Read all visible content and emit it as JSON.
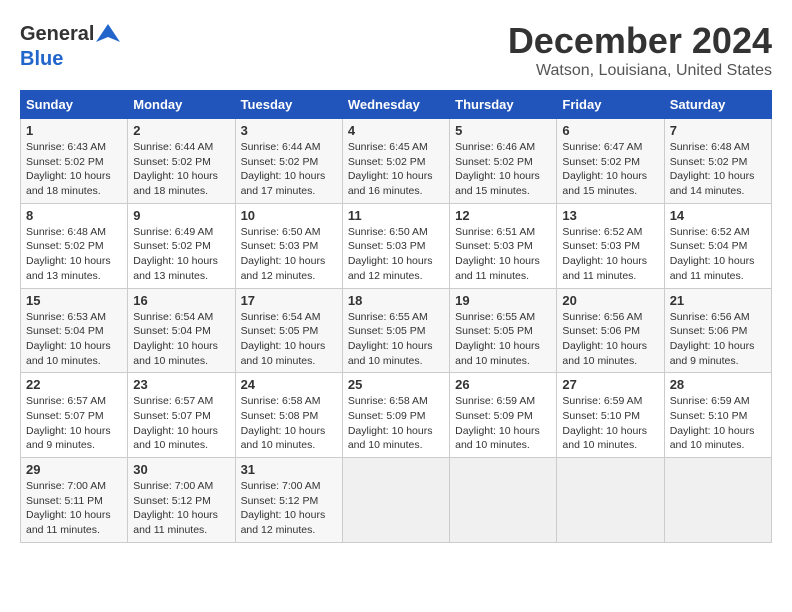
{
  "logo": {
    "general": "General",
    "blue": "Blue"
  },
  "title": "December 2024",
  "location": "Watson, Louisiana, United States",
  "days_header": [
    "Sunday",
    "Monday",
    "Tuesday",
    "Wednesday",
    "Thursday",
    "Friday",
    "Saturday"
  ],
  "weeks": [
    [
      {
        "day": "1",
        "info": "Sunrise: 6:43 AM\nSunset: 5:02 PM\nDaylight: 10 hours\nand 18 minutes."
      },
      {
        "day": "2",
        "info": "Sunrise: 6:44 AM\nSunset: 5:02 PM\nDaylight: 10 hours\nand 18 minutes."
      },
      {
        "day": "3",
        "info": "Sunrise: 6:44 AM\nSunset: 5:02 PM\nDaylight: 10 hours\nand 17 minutes."
      },
      {
        "day": "4",
        "info": "Sunrise: 6:45 AM\nSunset: 5:02 PM\nDaylight: 10 hours\nand 16 minutes."
      },
      {
        "day": "5",
        "info": "Sunrise: 6:46 AM\nSunset: 5:02 PM\nDaylight: 10 hours\nand 15 minutes."
      },
      {
        "day": "6",
        "info": "Sunrise: 6:47 AM\nSunset: 5:02 PM\nDaylight: 10 hours\nand 15 minutes."
      },
      {
        "day": "7",
        "info": "Sunrise: 6:48 AM\nSunset: 5:02 PM\nDaylight: 10 hours\nand 14 minutes."
      }
    ],
    [
      {
        "day": "8",
        "info": "Sunrise: 6:48 AM\nSunset: 5:02 PM\nDaylight: 10 hours\nand 13 minutes."
      },
      {
        "day": "9",
        "info": "Sunrise: 6:49 AM\nSunset: 5:02 PM\nDaylight: 10 hours\nand 13 minutes."
      },
      {
        "day": "10",
        "info": "Sunrise: 6:50 AM\nSunset: 5:03 PM\nDaylight: 10 hours\nand 12 minutes."
      },
      {
        "day": "11",
        "info": "Sunrise: 6:50 AM\nSunset: 5:03 PM\nDaylight: 10 hours\nand 12 minutes."
      },
      {
        "day": "12",
        "info": "Sunrise: 6:51 AM\nSunset: 5:03 PM\nDaylight: 10 hours\nand 11 minutes."
      },
      {
        "day": "13",
        "info": "Sunrise: 6:52 AM\nSunset: 5:03 PM\nDaylight: 10 hours\nand 11 minutes."
      },
      {
        "day": "14",
        "info": "Sunrise: 6:52 AM\nSunset: 5:04 PM\nDaylight: 10 hours\nand 11 minutes."
      }
    ],
    [
      {
        "day": "15",
        "info": "Sunrise: 6:53 AM\nSunset: 5:04 PM\nDaylight: 10 hours\nand 10 minutes."
      },
      {
        "day": "16",
        "info": "Sunrise: 6:54 AM\nSunset: 5:04 PM\nDaylight: 10 hours\nand 10 minutes."
      },
      {
        "day": "17",
        "info": "Sunrise: 6:54 AM\nSunset: 5:05 PM\nDaylight: 10 hours\nand 10 minutes."
      },
      {
        "day": "18",
        "info": "Sunrise: 6:55 AM\nSunset: 5:05 PM\nDaylight: 10 hours\nand 10 minutes."
      },
      {
        "day": "19",
        "info": "Sunrise: 6:55 AM\nSunset: 5:05 PM\nDaylight: 10 hours\nand 10 minutes."
      },
      {
        "day": "20",
        "info": "Sunrise: 6:56 AM\nSunset: 5:06 PM\nDaylight: 10 hours\nand 10 minutes."
      },
      {
        "day": "21",
        "info": "Sunrise: 6:56 AM\nSunset: 5:06 PM\nDaylight: 10 hours\nand 9 minutes."
      }
    ],
    [
      {
        "day": "22",
        "info": "Sunrise: 6:57 AM\nSunset: 5:07 PM\nDaylight: 10 hours\nand 9 minutes."
      },
      {
        "day": "23",
        "info": "Sunrise: 6:57 AM\nSunset: 5:07 PM\nDaylight: 10 hours\nand 10 minutes."
      },
      {
        "day": "24",
        "info": "Sunrise: 6:58 AM\nSunset: 5:08 PM\nDaylight: 10 hours\nand 10 minutes."
      },
      {
        "day": "25",
        "info": "Sunrise: 6:58 AM\nSunset: 5:09 PM\nDaylight: 10 hours\nand 10 minutes."
      },
      {
        "day": "26",
        "info": "Sunrise: 6:59 AM\nSunset: 5:09 PM\nDaylight: 10 hours\nand 10 minutes."
      },
      {
        "day": "27",
        "info": "Sunrise: 6:59 AM\nSunset: 5:10 PM\nDaylight: 10 hours\nand 10 minutes."
      },
      {
        "day": "28",
        "info": "Sunrise: 6:59 AM\nSunset: 5:10 PM\nDaylight: 10 hours\nand 10 minutes."
      }
    ],
    [
      {
        "day": "29",
        "info": "Sunrise: 7:00 AM\nSunset: 5:11 PM\nDaylight: 10 hours\nand 11 minutes."
      },
      {
        "day": "30",
        "info": "Sunrise: 7:00 AM\nSunset: 5:12 PM\nDaylight: 10 hours\nand 11 minutes."
      },
      {
        "day": "31",
        "info": "Sunrise: 7:00 AM\nSunset: 5:12 PM\nDaylight: 10 hours\nand 12 minutes."
      },
      {
        "day": "",
        "info": ""
      },
      {
        "day": "",
        "info": ""
      },
      {
        "day": "",
        "info": ""
      },
      {
        "day": "",
        "info": ""
      }
    ]
  ]
}
